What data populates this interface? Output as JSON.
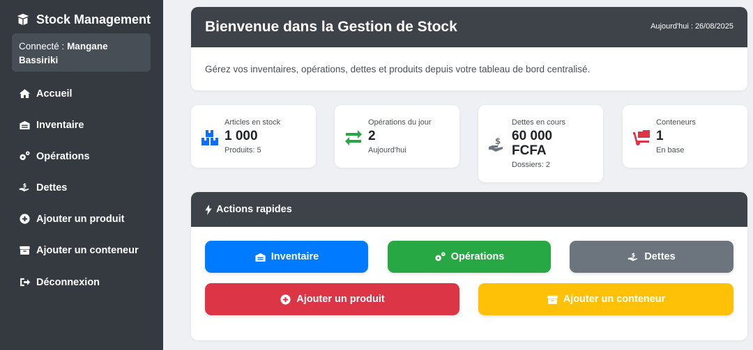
{
  "sidebar": {
    "brand": "Stock Management",
    "user_prefix": "Connecté :",
    "user_name": "Mangane Bassiriki",
    "items": [
      {
        "label": "Accueil",
        "icon": "home-icon"
      },
      {
        "label": "Inventaire",
        "icon": "warehouse-icon"
      },
      {
        "label": "Opérations",
        "icon": "gears-icon"
      },
      {
        "label": "Dettes",
        "icon": "hand-dollar-icon"
      },
      {
        "label": "Ajouter un produit",
        "icon": "plus-circle-icon"
      },
      {
        "label": "Ajouter un conteneur",
        "icon": "box-icon"
      },
      {
        "label": "Déconnexion",
        "icon": "logout-icon"
      }
    ]
  },
  "welcome": {
    "title": "Bienvenue dans la Gestion de Stock",
    "date": "Aujourd'hui : 26/08/2025",
    "description": "Gérez vos inventaires, opérations, dettes et produits depuis votre tableau de bord centralisé."
  },
  "stats": [
    {
      "label": "Articles en stock",
      "value": "1 000",
      "sub": "Produits: 5",
      "icon": "boxes-icon",
      "color": "#0d6efd"
    },
    {
      "label": "Opérations du jour",
      "value": "2",
      "sub": "Aujourd'hui",
      "icon": "exchange-icon",
      "color": "#28a745"
    },
    {
      "label": "Dettes en cours",
      "value": "60 000 FCFA",
      "sub": "Dossiers: 2",
      "icon": "hand-dollar-icon",
      "color": "#6c757d"
    },
    {
      "label": "Conteneurs",
      "value": "1",
      "sub": "En base",
      "icon": "dolly-icon",
      "color": "#dc3545"
    }
  ],
  "actions": {
    "title": "Actions rapides",
    "buttons": [
      {
        "label": "Inventaire",
        "icon": "warehouse-icon",
        "color": "#007bff"
      },
      {
        "label": "Opérations",
        "icon": "gears-icon",
        "color": "#28a745"
      },
      {
        "label": "Dettes",
        "icon": "hand-dollar-icon",
        "color": "#6c757d"
      },
      {
        "label": "Ajouter un produit",
        "icon": "plus-circle-icon",
        "color": "#dc3545"
      },
      {
        "label": "Ajouter un conteneur",
        "icon": "box-icon",
        "color": "#ffc107"
      }
    ]
  }
}
